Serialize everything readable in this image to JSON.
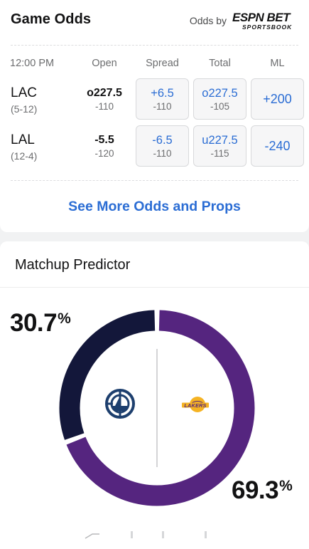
{
  "odds": {
    "title": "Game Odds",
    "odds_by_label": "Odds by",
    "provider_logo": "espn-bet-sportsbook-logo",
    "provider_text_primary": "ESPN BET",
    "provider_text_secondary": "SPORTSBOOK",
    "game_time": "12:00 PM",
    "columns": [
      "Open",
      "Spread",
      "Total",
      "ML"
    ],
    "teams": [
      {
        "abbr": "LAC",
        "record": "(5-12)",
        "open": {
          "main": "o227.5",
          "sub": "-110"
        },
        "spread": {
          "main": "+6.5",
          "sub": "-110"
        },
        "total": {
          "main": "o227.5",
          "sub": "-105"
        },
        "ml": "+200"
      },
      {
        "abbr": "LAL",
        "record": "(12-4)",
        "open": {
          "main": "-5.5",
          "sub": "-120"
        },
        "spread": {
          "main": "-6.5",
          "sub": "-110"
        },
        "total": {
          "main": "u227.5",
          "sub": "-115"
        },
        "ml": "-240"
      }
    ],
    "see_more": "See More Odds and Props"
  },
  "predictor": {
    "title": "Matchup Predictor",
    "away": {
      "team": "LAC",
      "value": "30.7",
      "probability": 30.7,
      "color": "#13173a",
      "logo": "clippers-logo"
    },
    "home": {
      "team": "LAL",
      "value": "69.3",
      "probability": 69.3,
      "color": "#55257f",
      "logo": "lakers-logo"
    },
    "percent_symbol": "%"
  },
  "colors": {
    "link": "#2b6dd4",
    "clippers_navy": "#13173a",
    "lakers_purple": "#55257f",
    "lakers_gold": "#f5b323"
  }
}
